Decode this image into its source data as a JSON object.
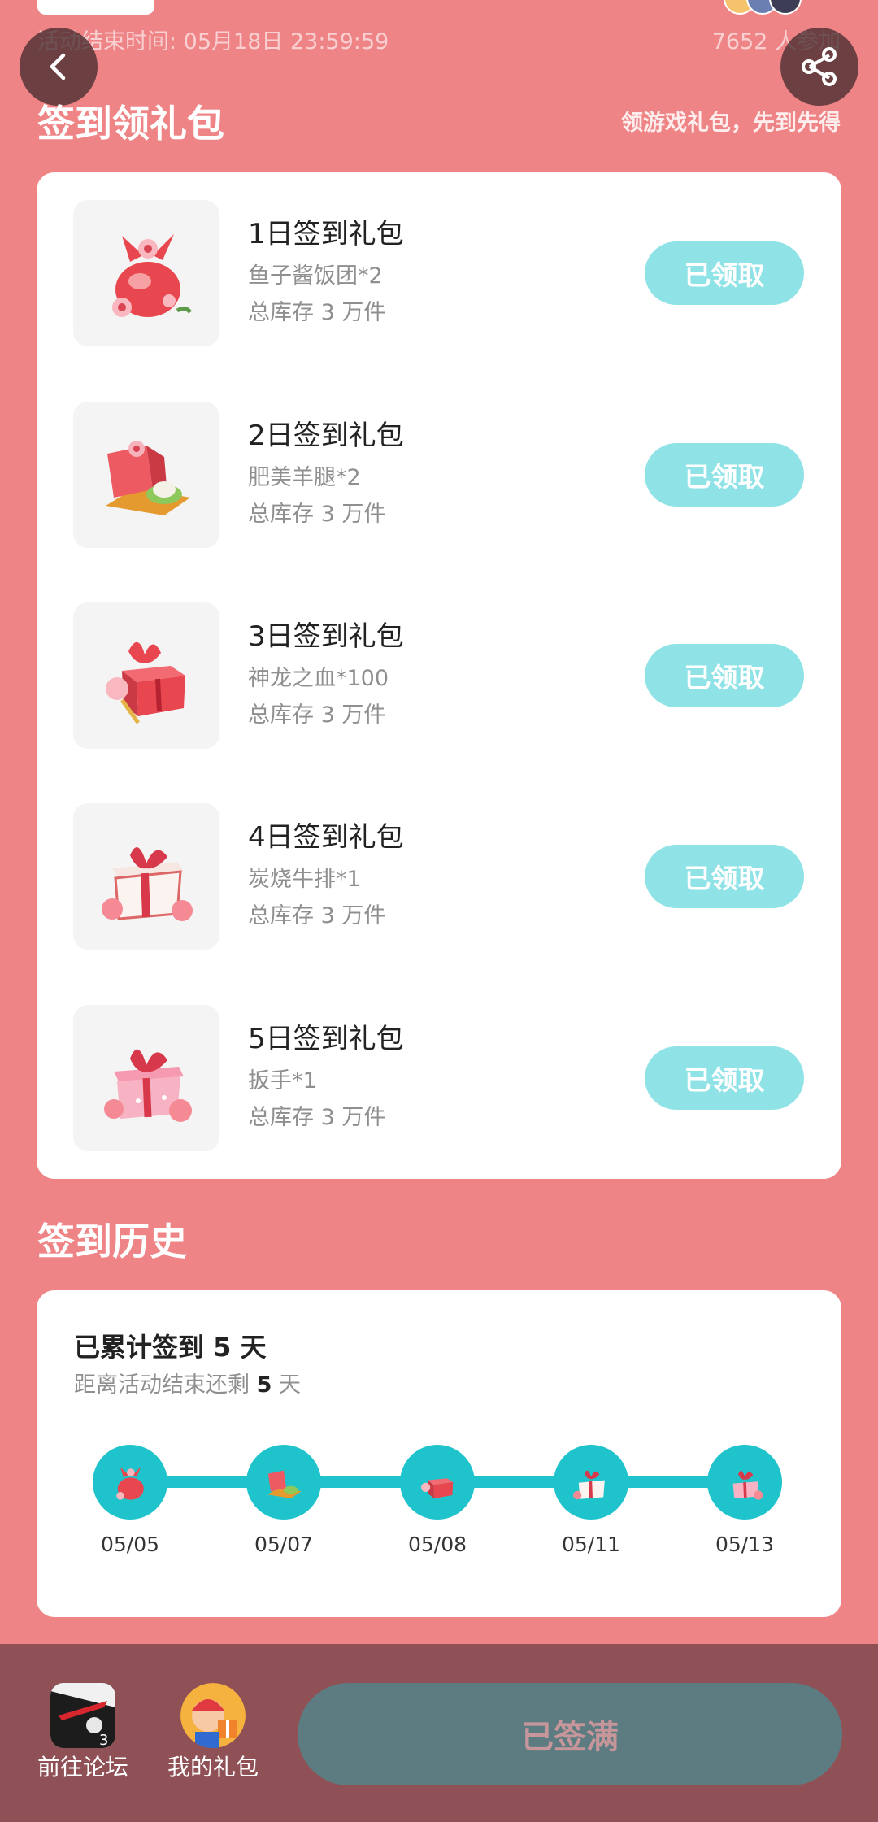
{
  "header": {
    "end_time": "活动结束时间: 05月18日 23:59:59",
    "participants": "7652 人参加",
    "back_icon": "chevron-left-icon",
    "share_icon": "share-icon"
  },
  "signin_section": {
    "title": "签到领礼包",
    "note": "领游戏礼包，先到先得",
    "gifts": [
      {
        "title": "1日签到礼包",
        "item": "鱼子酱饭团*2",
        "stock": "总库存 3 万件",
        "button": "已领取",
        "icon": "flower-bag-icon"
      },
      {
        "title": "2日签到礼包",
        "item": "肥美羊腿*2",
        "stock": "总库存 3 万件",
        "button": "已领取",
        "icon": "gift-box-open-icon"
      },
      {
        "title": "3日签到礼包",
        "item": "神龙之血*100",
        "stock": "总库存 3 万件",
        "button": "已领取",
        "icon": "gift-box-ribbon-icon"
      },
      {
        "title": "4日签到礼包",
        "item": "炭烧牛排*1",
        "stock": "总库存 3 万件",
        "button": "已领取",
        "icon": "gift-box-white-icon"
      },
      {
        "title": "5日签到礼包",
        "item": "扳手*1",
        "stock": "总库存 3 万件",
        "button": "已领取",
        "icon": "gift-box-pink-icon"
      }
    ]
  },
  "history_section": {
    "title": "签到历史",
    "count_prefix": "已累计签到",
    "count_value": "5",
    "count_suffix": "天",
    "remain_prefix": "距离活动结束还剩",
    "remain_value": "5",
    "remain_suffix": "天",
    "dates": [
      "05/05",
      "05/07",
      "05/08",
      "05/11",
      "05/13"
    ]
  },
  "bottom_bar": {
    "forum_label": "前往论坛",
    "gifts_label": "我的礼包",
    "sign_button": "已签满"
  },
  "colors": {
    "background": "#ef8486",
    "claim_button": "#8fe3e6",
    "timeline": "#1fc3cc",
    "bottom_bar": "#8f5156",
    "sign_button": "#5c7c82"
  }
}
